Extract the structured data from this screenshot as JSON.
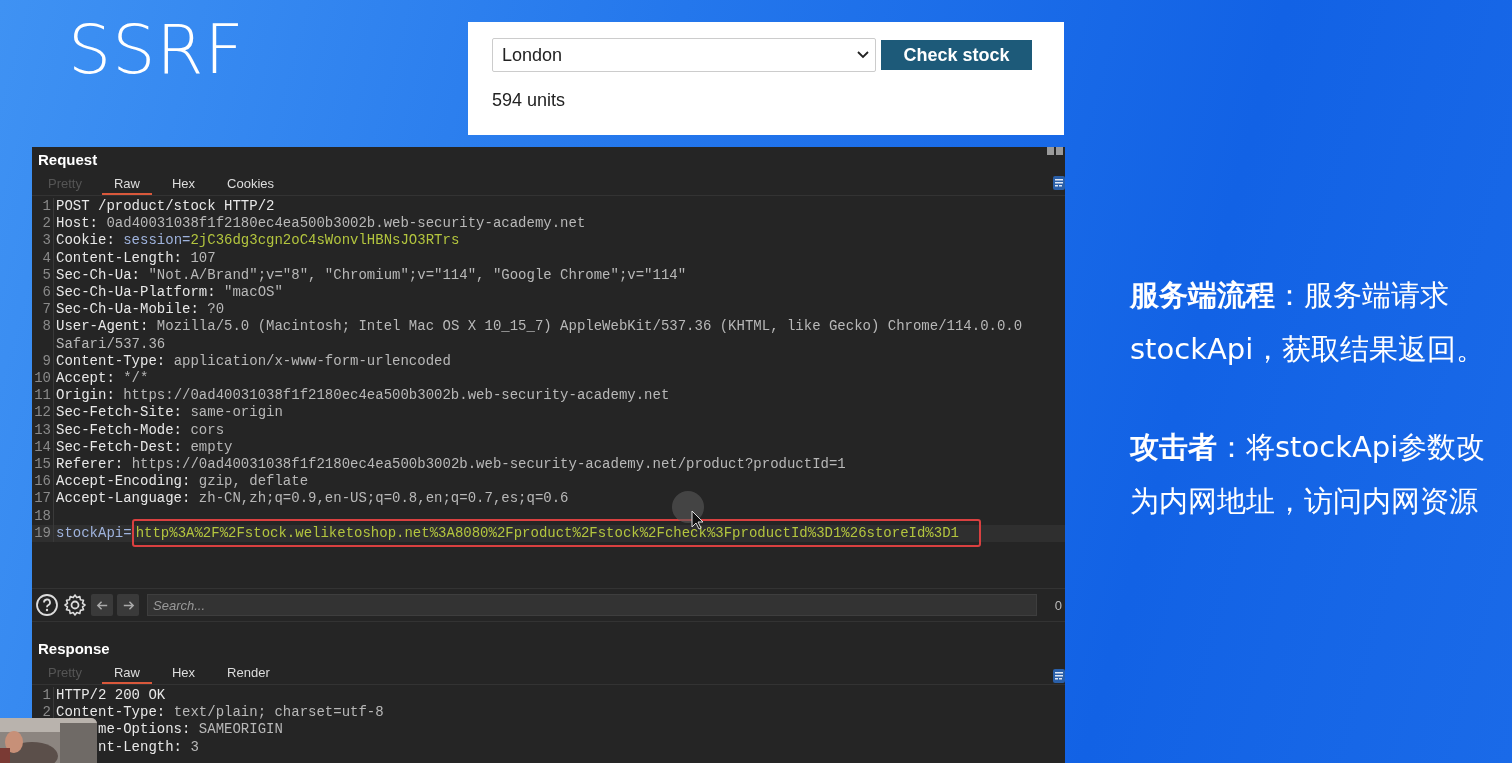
{
  "slide_title": "SSRF",
  "stock_widget": {
    "store": "London",
    "button": "Check stock",
    "result": "594 units"
  },
  "request": {
    "title": "Request",
    "tabs": [
      {
        "label": "Pretty",
        "selected": false,
        "disabled": true
      },
      {
        "label": "Raw",
        "selected": true,
        "disabled": false
      },
      {
        "label": "Hex",
        "selected": false,
        "disabled": false
      },
      {
        "label": "Cookies",
        "selected": false,
        "disabled": false
      }
    ],
    "lines": [
      {
        "number": "1",
        "segments": [
          {
            "text": "POST /product/stock HTTP/2",
            "kind": "key"
          }
        ]
      },
      {
        "number": "2",
        "segments": [
          {
            "text": "Host: ",
            "kind": "key"
          },
          {
            "text": "0ad40031038f1f2180ec4ea500b3002b.web-security-academy.net",
            "kind": "text"
          }
        ]
      },
      {
        "number": "3",
        "segments": [
          {
            "text": "Cookie: ",
            "kind": "key"
          },
          {
            "text": "session=",
            "kind": "param"
          },
          {
            "text": "2jC36dg3cgn2oC4sWonvlHBNsJO3RTrs",
            "kind": "value"
          }
        ]
      },
      {
        "number": "4",
        "segments": [
          {
            "text": "Content-Length: ",
            "kind": "key"
          },
          {
            "text": "107",
            "kind": "text"
          }
        ]
      },
      {
        "number": "5",
        "segments": [
          {
            "text": "Sec-Ch-Ua: ",
            "kind": "key"
          },
          {
            "text": "\"Not.A/Brand\";v=\"8\", \"Chromium\";v=\"114\", \"Google Chrome\";v=\"114\"",
            "kind": "text"
          }
        ]
      },
      {
        "number": "6",
        "segments": [
          {
            "text": "Sec-Ch-Ua-Platform: ",
            "kind": "key"
          },
          {
            "text": "\"macOS\"",
            "kind": "text"
          }
        ]
      },
      {
        "number": "7",
        "segments": [
          {
            "text": "Sec-Ch-Ua-Mobile: ",
            "kind": "key"
          },
          {
            "text": "?0",
            "kind": "text"
          }
        ]
      },
      {
        "number": "8",
        "segments": [
          {
            "text": "User-Agent: ",
            "kind": "key"
          },
          {
            "text": "Mozilla/5.0 (Macintosh; Intel Mac OS X 10_15_7) AppleWebKit/537.36 (KHTML, like Gecko) Chrome/114.0.0.0 Safari/537.36",
            "kind": "text"
          }
        ]
      },
      {
        "number": "9",
        "segments": [
          {
            "text": "Content-Type: ",
            "kind": "key"
          },
          {
            "text": "application/x-www-form-urlencoded",
            "kind": "text"
          }
        ]
      },
      {
        "number": "10",
        "segments": [
          {
            "text": "Accept: ",
            "kind": "key"
          },
          {
            "text": "*/*",
            "kind": "text"
          }
        ]
      },
      {
        "number": "11",
        "segments": [
          {
            "text": "Origin: ",
            "kind": "key"
          },
          {
            "text": "https://0ad40031038f1f2180ec4ea500b3002b.web-security-academy.net",
            "kind": "text"
          }
        ]
      },
      {
        "number": "12",
        "segments": [
          {
            "text": "Sec-Fetch-Site: ",
            "kind": "key"
          },
          {
            "text": "same-origin",
            "kind": "text"
          }
        ]
      },
      {
        "number": "13",
        "segments": [
          {
            "text": "Sec-Fetch-Mode: ",
            "kind": "key"
          },
          {
            "text": "cors",
            "kind": "text"
          }
        ]
      },
      {
        "number": "14",
        "segments": [
          {
            "text": "Sec-Fetch-Dest: ",
            "kind": "key"
          },
          {
            "text": "empty",
            "kind": "text"
          }
        ]
      },
      {
        "number": "15",
        "segments": [
          {
            "text": "Referer: ",
            "kind": "key"
          },
          {
            "text": "https://0ad40031038f1f2180ec4ea500b3002b.web-security-academy.net/product?productId=1",
            "kind": "text"
          }
        ]
      },
      {
        "number": "16",
        "segments": [
          {
            "text": "Accept-Encoding: ",
            "kind": "key"
          },
          {
            "text": "gzip, deflate",
            "kind": "text"
          }
        ]
      },
      {
        "number": "17",
        "segments": [
          {
            "text": "Accept-Language: ",
            "kind": "key"
          },
          {
            "text": "zh-CN,zh;q=0.9,en-US;q=0.8,en;q=0.7,es;q=0.6",
            "kind": "text"
          }
        ]
      },
      {
        "number": "18"
      },
      {
        "number": "19",
        "segments": [
          {
            "text": "stockApi=",
            "kind": "param"
          },
          {
            "text": "http%3A%2F%2Fstock.weliketoshop.net%3A8080%2Fproduct%2Fstock%2Fcheck%3FproductId%3D1%26storeId%3D1",
            "kind": "boxed"
          }
        ]
      }
    ]
  },
  "search": {
    "placeholder": "Search...",
    "count": "0"
  },
  "response": {
    "title": "Response",
    "tabs": [
      {
        "label": "Pretty",
        "selected": false,
        "disabled": true
      },
      {
        "label": "Raw",
        "selected": true,
        "disabled": false
      },
      {
        "label": "Hex",
        "selected": false,
        "disabled": false
      },
      {
        "label": "Render",
        "selected": false,
        "disabled": false
      }
    ],
    "lines": [
      {
        "number": "1",
        "segments": [
          {
            "text": "HTTP/2 200 OK",
            "kind": "key"
          }
        ]
      },
      {
        "number": "2",
        "segments": [
          {
            "text": "Content-Type: ",
            "kind": "key"
          },
          {
            "text": "text/plain; charset=utf-8",
            "kind": "text"
          }
        ]
      },
      {
        "covered": true,
        "segments": [
          {
            "text": "me-Options: ",
            "kind": "key"
          },
          {
            "text": "SAMEORIGIN",
            "kind": "text"
          }
        ]
      },
      {
        "covered": true,
        "segments": [
          {
            "text": "nt-Length: ",
            "kind": "key"
          },
          {
            "text": "3",
            "kind": "text"
          }
        ]
      }
    ]
  },
  "notes": [
    {
      "text": "**服务端流程**：服务端请求stockApi，获取结果返回。"
    },
    {
      "text": "**攻击者**：将stockApi参数改为内网地址，访问内网资源"
    }
  ]
}
